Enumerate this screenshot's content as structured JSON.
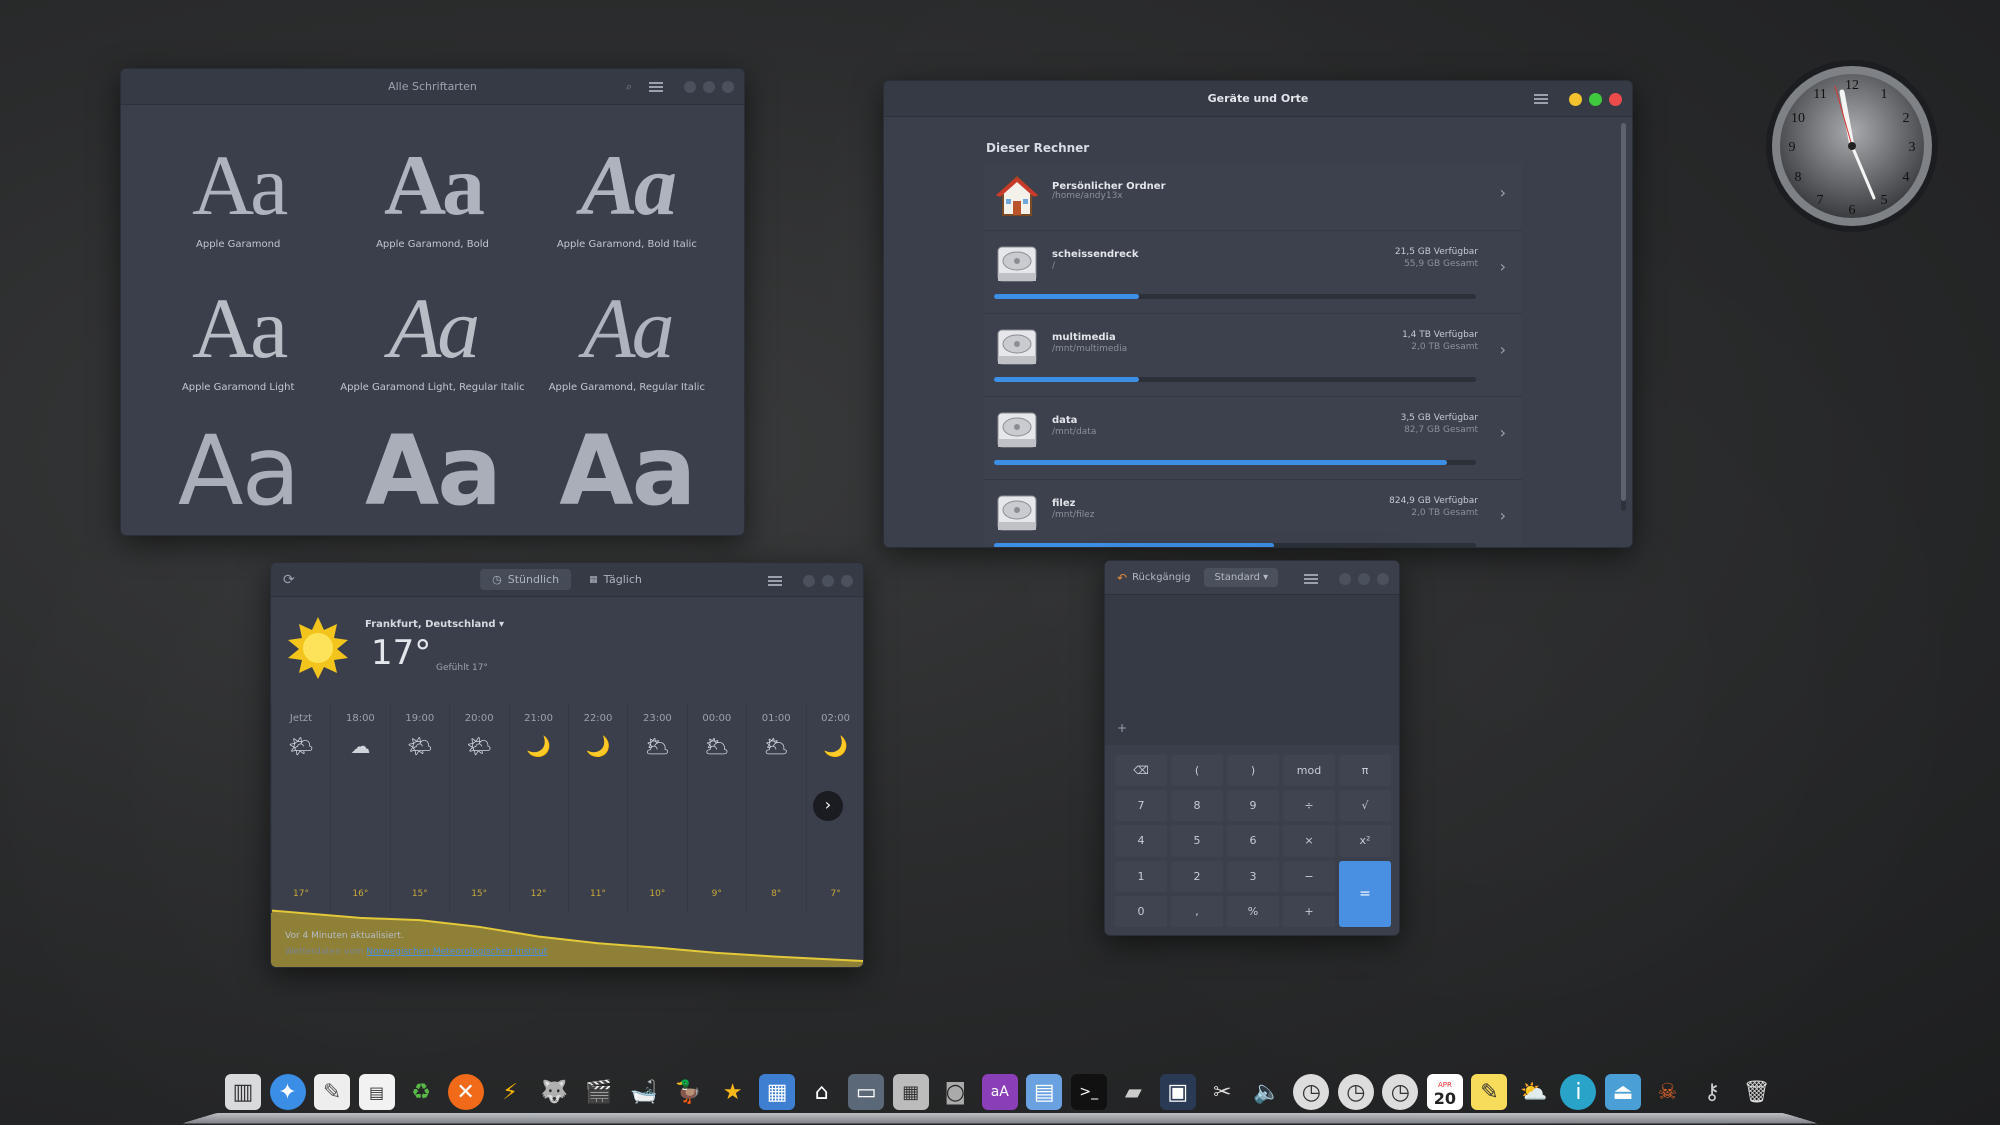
{
  "fonts_window": {
    "title": "Alle Schriftarten",
    "sample": "Aa",
    "fonts": [
      {
        "name": "Apple Garamond",
        "style": "regular"
      },
      {
        "name": "Apple Garamond, Bold",
        "style": "bold"
      },
      {
        "name": "Apple Garamond, Bold Italic",
        "style": "bolditalic"
      },
      {
        "name": "Apple Garamond Light",
        "style": "light"
      },
      {
        "name": "Apple Garamond Light, Regular Italic",
        "style": "lightitalic"
      },
      {
        "name": "Apple Garamond, Regular Italic",
        "style": "italic"
      },
      {
        "name": "",
        "style": "sans"
      },
      {
        "name": "",
        "style": "sansbold"
      },
      {
        "name": "",
        "style": "sansbold"
      }
    ]
  },
  "files_window": {
    "title": "Geräte und Orte",
    "section": "Dieser Rechner",
    "home": {
      "name": "Persönlicher Ordner",
      "path": "/home/andy13x"
    },
    "devices": [
      {
        "name": "scheissendreck",
        "path": "/",
        "free": "21,5 GB Verfügbar",
        "total": "55,9 GB Gesamt",
        "used_fraction": 0.3
      },
      {
        "name": "multimedia",
        "path": "/mnt/multimedia",
        "free": "1,4 TB Verfügbar",
        "total": "2,0 TB Gesamt",
        "used_fraction": 0.3
      },
      {
        "name": "data",
        "path": "/mnt/data",
        "free": "3,5 GB Verfügbar",
        "total": "82,7 GB Gesamt",
        "used_fraction": 0.94
      },
      {
        "name": "filez",
        "path": "/mnt/filez",
        "free": "824,9 GB Verfügbar",
        "total": "2,0 TB Gesamt",
        "used_fraction": 0.58
      }
    ]
  },
  "weather_window": {
    "tab_hourly": "Stündlich",
    "tab_daily": "Täglich",
    "location": "Frankfurt, Deutschland",
    "temperature": "17°",
    "feels_like": "Gefühlt 17°",
    "hours": [
      {
        "time": "Jetzt",
        "icon": "partly-sunny-icon",
        "temp": "17°",
        "temp_value": 17
      },
      {
        "time": "18:00",
        "icon": "cloudy-icon",
        "temp": "16°",
        "temp_value": 16
      },
      {
        "time": "19:00",
        "icon": "partly-sunny-icon",
        "temp": "15°",
        "temp_value": 15.7
      },
      {
        "time": "20:00",
        "icon": "partly-sunny-icon",
        "temp": "15°",
        "temp_value": 14.8
      },
      {
        "time": "21:00",
        "icon": "moon-icon",
        "temp": "12°",
        "temp_value": 13.5
      },
      {
        "time": "22:00",
        "icon": "moon-icon",
        "temp": "11°",
        "temp_value": 12.6
      },
      {
        "time": "23:00",
        "icon": "moon-cloud-icon",
        "temp": "10°",
        "temp_value": 12
      },
      {
        "time": "00:00",
        "icon": "moon-cloud-icon",
        "temp": "9°",
        "temp_value": 11.3
      },
      {
        "time": "01:00",
        "icon": "moon-cloud-icon",
        "temp": "8°",
        "temp_value": 10.8
      },
      {
        "time": "02:00",
        "icon": "moon-icon",
        "temp": "7°",
        "temp_value": 10.4
      }
    ],
    "updated": "Vor 4 Minuten aktualisiert.",
    "source_prefix": "Wetterdaten vom",
    "source_link": "Norwegischen Meteorologischen Institut"
  },
  "calculator_window": {
    "undo_label": "Rückgängig",
    "mode": "Standard",
    "display_sign": "+",
    "keys": [
      "⌫",
      "(",
      ")",
      "mod",
      "π",
      "7",
      "8",
      "9",
      "÷",
      "√",
      "4",
      "5",
      "6",
      "×",
      "x²",
      "1",
      "2",
      "3",
      "−",
      "=",
      "0",
      ",",
      "%",
      "+"
    ]
  },
  "dock": {
    "calendar_month": "APR",
    "calendar_day": "20"
  },
  "colors": {
    "accent": "#4a90e2",
    "weather_fill": "#8e8036",
    "weather_line": "#e3c83a",
    "close": "#ec4b4b",
    "minimize": "#f2c12e",
    "maximize": "#3ec93e"
  }
}
